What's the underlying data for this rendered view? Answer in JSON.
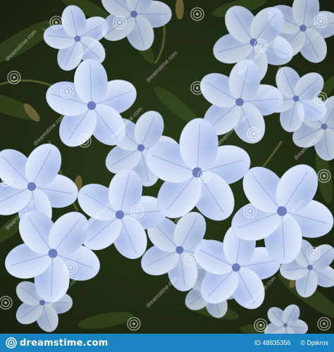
{
  "photo": {
    "subject": "Pale blue plumbago flower cluster",
    "colors": {
      "background_dark": "#1f2a14",
      "foliage": "#3e5422",
      "petal_light": "#dbe6f6",
      "petal_mid": "#b7c9ee",
      "petal_vein": "#8fa7dd",
      "flower_center": "#6d7fbf"
    }
  },
  "watermark": {
    "text": "dreamstime.com",
    "logo_icon": "spiral-logo-icon"
  },
  "footer": {
    "background_color": "#1a84c3",
    "brand_text": "dreamstime.com",
    "image_id": "ID 48835356",
    "author": "© Dpikros"
  }
}
